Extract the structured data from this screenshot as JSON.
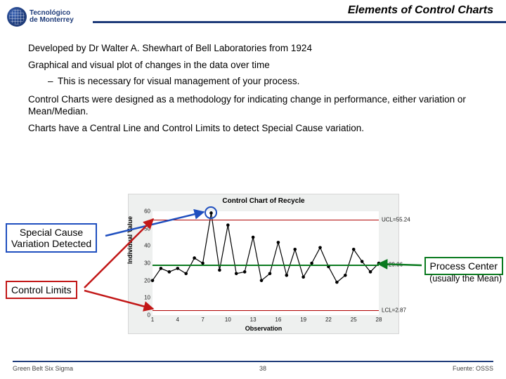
{
  "header": {
    "title": "Elements of Control Charts",
    "logo_line1": "Tecnológico",
    "logo_line2": "de Monterrey"
  },
  "body": {
    "p1": "Developed by Dr Walter A. Shewhart of Bell Laboratories from 1924",
    "p2": "Graphical and visual plot of changes in the data over time",
    "p2_sub": "This is necessary for visual management of your process.",
    "p3": "Control Charts were designed as a methodology for indicating change in performance, either variation or Mean/Median.",
    "p4": "Charts have a Central Line and Control Limits to detect Special Cause variation."
  },
  "callouts": {
    "special": "Special Cause\nVariation Detected",
    "limits": "Control Limits",
    "center": "Process Center",
    "center_sub": "(usually the Mean)"
  },
  "footer": {
    "left": "Green Belt Six Sigma",
    "center": "38",
    "right": "Fuente: OSSS"
  },
  "chart_data": {
    "type": "line",
    "title": "Control Chart of Recycle",
    "xlabel": "Observation",
    "ylabel": "Individual Value",
    "ylim": [
      0,
      60
    ],
    "yticks": [
      0,
      10,
      20,
      30,
      40,
      50,
      60
    ],
    "xticks": [
      1,
      4,
      7,
      10,
      13,
      16,
      19,
      22,
      25,
      28
    ],
    "mean": 29.06,
    "ucl": 55.24,
    "lcl": 2.87,
    "ref_labels": {
      "ucl": "UCL=55.24",
      "mean": "X=29.06",
      "lcl": "LCL=2.87"
    },
    "x": [
      1,
      2,
      3,
      4,
      5,
      6,
      7,
      8,
      9,
      10,
      11,
      12,
      13,
      14,
      15,
      16,
      17,
      18,
      19,
      20,
      21,
      22,
      23,
      24,
      25,
      26,
      27,
      28
    ],
    "values": [
      20,
      27,
      25,
      27,
      24,
      33,
      30,
      59,
      26,
      52,
      24,
      25,
      45,
      20,
      24,
      42,
      23,
      38,
      22,
      30,
      39,
      28,
      19,
      23,
      38,
      31,
      25,
      30
    ],
    "special_index": 7
  }
}
